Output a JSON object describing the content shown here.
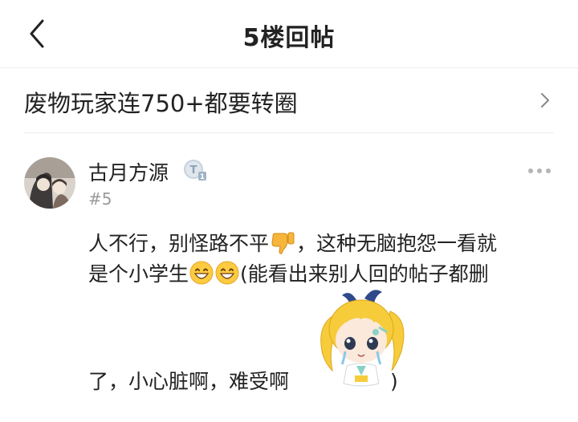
{
  "header": {
    "title": "5楼回帖"
  },
  "thread": {
    "title": "废物玩家连750+都要转圈"
  },
  "post": {
    "username": "古月方源",
    "floor": "#5",
    "line1_a": "人不行，别怪路不平",
    "line1_b": "，这种无脑抱怨一看就",
    "line2_a": "是个小学生",
    "line2_b": "(能看出来别人回的帖子都删",
    "line3_a": "了，小心脏啊，难受啊",
    "line3_b": ")"
  },
  "icons": {
    "back": "chevron-left-icon",
    "thread": "chevron-right-icon",
    "more": "more-dots-icon",
    "badge": "level-badge-icon",
    "emoji1": "thumbs-down-emoji",
    "emoji2": "grinning-emoji",
    "sticker": "anime-sticker"
  },
  "colors": {
    "divider": "#ececec",
    "muted": "#9a9a9a",
    "badge": "#9fb2c6"
  }
}
